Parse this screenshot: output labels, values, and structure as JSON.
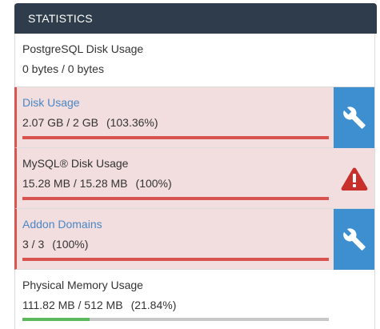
{
  "panel": {
    "title": "STATISTICS"
  },
  "stats": [
    {
      "name": "PostgreSQL Disk Usage",
      "value": "0 bytes / 0 bytes",
      "percent": "",
      "alert": false
    },
    {
      "name": "Disk Usage",
      "value": "2.07 GB / 2 GB",
      "percent": "(103.36%)",
      "usage_fraction": 1.0,
      "alert": true,
      "action_icon": "wrench-icon"
    },
    {
      "name": "MySQL® Disk Usage",
      "value": "15.28 MB / 15.28 MB",
      "percent": "(100%)",
      "usage_fraction": 1.0,
      "alert": true,
      "action_icon": "warning-icon"
    },
    {
      "name": "Addon Domains",
      "value": "3 / 3",
      "percent": "(100%)",
      "usage_fraction": 1.0,
      "alert": true,
      "action_icon": "wrench-icon"
    },
    {
      "name": "Physical Memory Usage",
      "value": "111.82 MB / 512 MB",
      "percent": "(21.84%)",
      "usage_fraction": 0.2184,
      "alert": false
    }
  ],
  "colors": {
    "header_bg": "#2e3c4b",
    "alert_bg": "#f2dede",
    "alert_bar": "#d9534f",
    "ok_bar": "#5cb85c",
    "action_blue": "#3d8fd0",
    "link": "#4a86c5"
  }
}
